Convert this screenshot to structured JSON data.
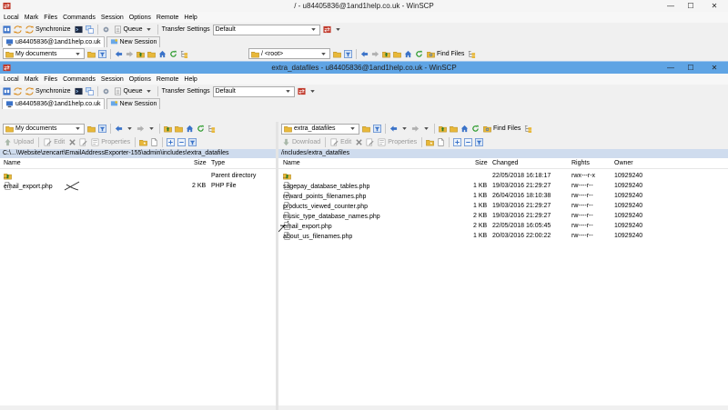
{
  "colors": {
    "title_active": "#5fa4e4",
    "path_bar": "#cfdcee",
    "folder": "#e8b83a"
  },
  "back_window": {
    "title": "/ - u84405836@1and1help.co.uk - WinSCP",
    "tab_session": "u84405836@1and1help.co.uk",
    "tab_new": "New Session",
    "left_location": "My documents",
    "right_location": "/ <root>",
    "find_files": "Find Files"
  },
  "front_window": {
    "title": "extra_datafiles - u84405836@1and1help.co.uk - WinSCP",
    "tab_session": "u84405836@1and1help.co.uk",
    "tab_new": "New Session"
  },
  "window_controls": {
    "minimize": "—",
    "maximize": "☐",
    "close": "✕"
  },
  "menu": [
    "Local",
    "Mark",
    "Files",
    "Commands",
    "Session",
    "Options",
    "Remote",
    "Help"
  ],
  "toolbar": {
    "synchronize": "Synchronize",
    "queue": "Queue",
    "transfer_settings_label": "Transfer Settings",
    "transfer_settings_value": "Default"
  },
  "left_pane": {
    "location": "My documents",
    "upload": "Upload",
    "edit": "Edit",
    "properties": "Properties",
    "path": "C:\\...\\Website\\zencart\\EmailAddressExporter-155\\admin\\includes\\extra_datafiles",
    "columns": {
      "name": "Name",
      "size": "Size",
      "type": "Type"
    },
    "rows": [
      {
        "name": "..",
        "size": "",
        "type": "Parent directory",
        "icon": "folder-up-icon"
      },
      {
        "name": "email_export.php",
        "size": "2 KB",
        "type": "PHP File",
        "icon": "file-icon"
      }
    ]
  },
  "right_pane": {
    "location": "extra_datafiles",
    "download": "Download",
    "edit": "Edit",
    "properties": "Properties",
    "find_files": "Find Files",
    "path": "/includes/extra_datafiles",
    "columns": {
      "name": "Name",
      "size": "Size",
      "changed": "Changed",
      "rights": "Rights",
      "owner": "Owner"
    },
    "rows": [
      {
        "name": "..",
        "size": "",
        "changed": "22/05/2018 16:18:17",
        "rights": "rwx---r-x",
        "owner": "10929240",
        "icon": "folder-up-icon"
      },
      {
        "name": "sagepay_database_tables.php",
        "size": "1 KB",
        "changed": "19/03/2016 21:29:27",
        "rights": "rw----r--",
        "owner": "10929240",
        "icon": "file-icon"
      },
      {
        "name": "reward_points_filenames.php",
        "size": "1 KB",
        "changed": "26/04/2016 18:10:38",
        "rights": "rw----r--",
        "owner": "10929240",
        "icon": "file-icon"
      },
      {
        "name": "products_viewed_counter.php",
        "size": "1 KB",
        "changed": "19/03/2016 21:29:27",
        "rights": "rw----r--",
        "owner": "10929240",
        "icon": "file-icon"
      },
      {
        "name": "music_type_database_names.php",
        "size": "2 KB",
        "changed": "19/03/2016 21:29:27",
        "rights": "rw----r--",
        "owner": "10929240",
        "icon": "file-icon"
      },
      {
        "name": "email_export.php",
        "size": "2 KB",
        "changed": "22/05/2018 16:05:45",
        "rights": "rw----r--",
        "owner": "10929240",
        "icon": "file-icon"
      },
      {
        "name": "about_us_filenames.php",
        "size": "1 KB",
        "changed": "20/03/2016 22:00:22",
        "rights": "rw----r--",
        "owner": "10929240",
        "icon": "file-icon"
      }
    ]
  }
}
